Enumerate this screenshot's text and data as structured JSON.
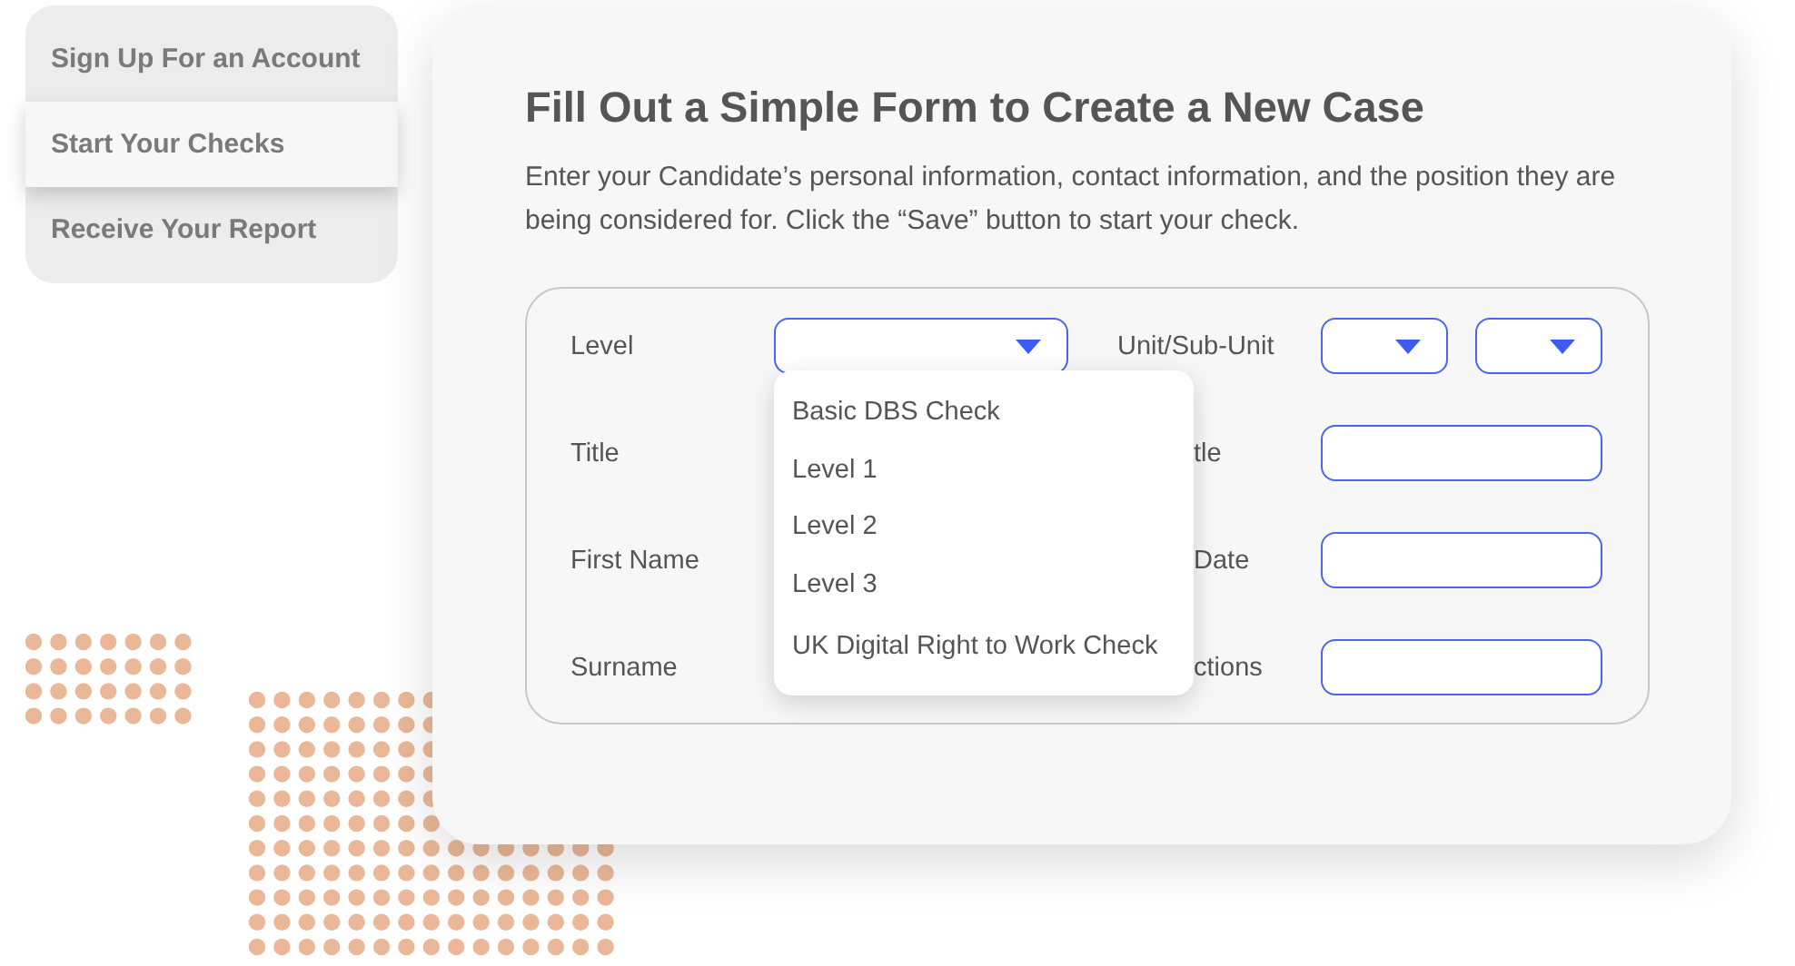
{
  "menu": {
    "items": [
      {
        "label": "Sign Up For an Account",
        "selected": false
      },
      {
        "label": "Start Your Checks",
        "selected": true
      },
      {
        "label": "Receive Your Report",
        "selected": false
      }
    ]
  },
  "card": {
    "title": "Fill Out a Simple Form to Create a New Case",
    "description": "Enter your Candidate’s personal information, contact information, and the position they are being considered for. Click the “Save” button to start your check."
  },
  "form": {
    "rows": [
      {
        "left": {
          "label": "Level",
          "control": {
            "kind": "select",
            "options": [
              "Basic DBS Check",
              "Level 1",
              "Level 2",
              "Level 3",
              "UK Digital Right to Work Check"
            ]
          }
        },
        "right": {
          "label": "Unit/Sub-Unit",
          "controls": [
            {
              "kind": "select"
            },
            {
              "kind": "select"
            }
          ]
        }
      },
      {
        "left": {
          "label": "Title"
        },
        "right": {
          "label": "tle",
          "controls": [
            {
              "kind": "input"
            }
          ]
        }
      },
      {
        "left": {
          "label": "First Name"
        },
        "right": {
          "label": "Date",
          "controls": [
            {
              "kind": "input"
            }
          ]
        }
      },
      {
        "left": {
          "label": "Surname"
        },
        "right": {
          "label": "ctions",
          "controls": [
            {
              "kind": "input"
            }
          ]
        }
      }
    ]
  }
}
